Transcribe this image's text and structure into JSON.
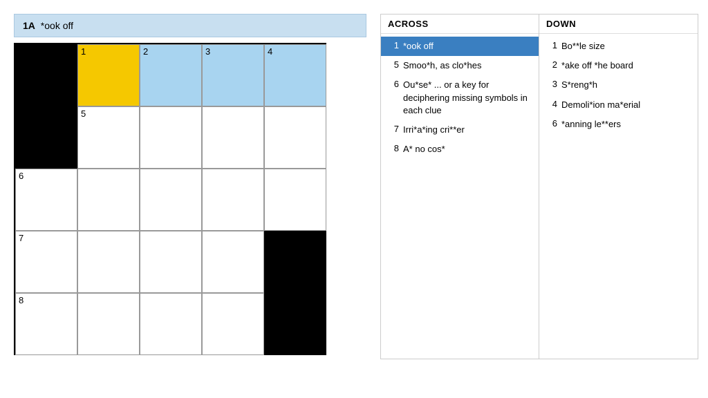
{
  "header": {
    "clue_id": "1A",
    "clue_text": "*ook off"
  },
  "grid": {
    "rows": 5,
    "cols": 5,
    "cells": [
      {
        "row": 0,
        "col": 0,
        "type": "black"
      },
      {
        "row": 0,
        "col": 1,
        "type": "yellow",
        "number": "1"
      },
      {
        "row": 0,
        "col": 2,
        "type": "blue",
        "number": "2"
      },
      {
        "row": 0,
        "col": 3,
        "type": "blue",
        "number": "3"
      },
      {
        "row": 0,
        "col": 4,
        "type": "blue",
        "number": "4"
      },
      {
        "row": 1,
        "col": 0,
        "type": "black"
      },
      {
        "row": 1,
        "col": 1,
        "type": "white",
        "number": "5"
      },
      {
        "row": 1,
        "col": 2,
        "type": "white"
      },
      {
        "row": 1,
        "col": 3,
        "type": "white"
      },
      {
        "row": 1,
        "col": 4,
        "type": "white"
      },
      {
        "row": 2,
        "col": 0,
        "type": "white",
        "number": "6"
      },
      {
        "row": 2,
        "col": 1,
        "type": "white"
      },
      {
        "row": 2,
        "col": 2,
        "type": "white"
      },
      {
        "row": 2,
        "col": 3,
        "type": "white"
      },
      {
        "row": 2,
        "col": 4,
        "type": "white"
      },
      {
        "row": 3,
        "col": 0,
        "type": "white",
        "number": "7"
      },
      {
        "row": 3,
        "col": 1,
        "type": "white"
      },
      {
        "row": 3,
        "col": 2,
        "type": "white"
      },
      {
        "row": 3,
        "col": 3,
        "type": "white"
      },
      {
        "row": 3,
        "col": 4,
        "type": "black"
      },
      {
        "row": 4,
        "col": 0,
        "type": "white",
        "number": "8"
      },
      {
        "row": 4,
        "col": 1,
        "type": "white"
      },
      {
        "row": 4,
        "col": 2,
        "type": "white"
      },
      {
        "row": 4,
        "col": 3,
        "type": "white"
      },
      {
        "row": 4,
        "col": 4,
        "type": "black"
      }
    ]
  },
  "across": {
    "header": "ACROSS",
    "clues": [
      {
        "number": "1",
        "text": "*ook off",
        "active": true
      },
      {
        "number": "5",
        "text": "Smoo*h, as clo*hes",
        "active": false
      },
      {
        "number": "6",
        "text": "Ou*se* ... or a key for deciphering missing symbols in each clue",
        "active": false
      },
      {
        "number": "7",
        "text": "Irri*a*ing cri**er",
        "active": false
      },
      {
        "number": "8",
        "text": "A* no cos*",
        "active": false
      }
    ]
  },
  "down": {
    "header": "DOWN",
    "clues": [
      {
        "number": "1",
        "text": "Bo**le size",
        "active": false
      },
      {
        "number": "2",
        "text": "*ake off *he board",
        "active": false
      },
      {
        "number": "3",
        "text": "S*reng*h",
        "active": false
      },
      {
        "number": "4",
        "text": "Demoli*ion ma*erial",
        "active": false
      },
      {
        "number": "6",
        "text": "*anning le**ers",
        "active": false
      }
    ]
  }
}
